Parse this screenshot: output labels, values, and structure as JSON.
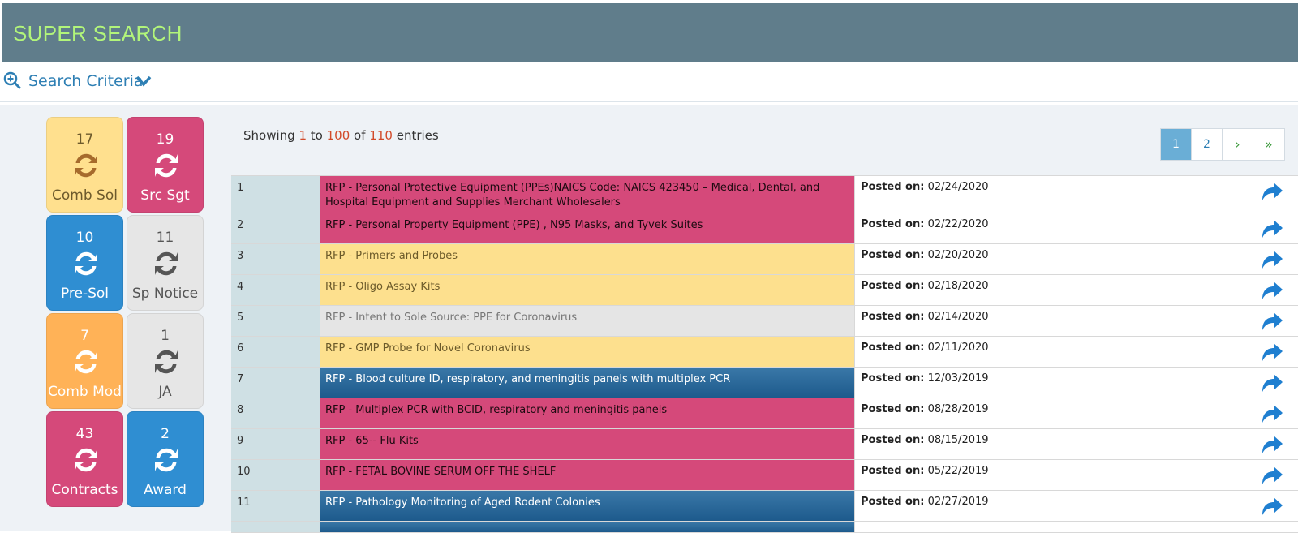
{
  "header": {
    "title": "SUPER SEARCH"
  },
  "criteria": {
    "label": "Search Criteria"
  },
  "tiles": [
    {
      "count": "17",
      "name": "Comb Sol"
    },
    {
      "count": "19",
      "name": "Src Sgt"
    },
    {
      "count": "10",
      "name": "Pre-Sol"
    },
    {
      "count": "11",
      "name": "Sp Notice"
    },
    {
      "count": "7",
      "name": "Comb Mod"
    },
    {
      "count": "1",
      "name": "JA"
    },
    {
      "count": "43",
      "name": "Contracts"
    },
    {
      "count": "2",
      "name": "Award"
    }
  ],
  "showing": {
    "prefix": "Showing",
    "from": "1",
    "to_word": "to",
    "to": "100",
    "of_word": "of",
    "total": "110",
    "suffix": "entries"
  },
  "pager": {
    "pages": [
      "1",
      "2"
    ],
    "next": "›",
    "last": "»"
  },
  "posted_label": "Posted on:",
  "rows": [
    {
      "num": "1",
      "title": "RFP - Personal Protective Equipment (PPEs)NAICS Code: NAICS 423450 – Medical, Dental, and Hospital Equipment and Supplies Merchant Wholesalers",
      "date": "02/24/2020"
    },
    {
      "num": "2",
      "title": "RFP - Personal Property Equipment (PPE) , N95 Masks, and Tyvek Suites",
      "date": "02/22/2020"
    },
    {
      "num": "3",
      "title": "RFP - Primers and Probes",
      "date": "02/20/2020"
    },
    {
      "num": "4",
      "title": "RFP - Oligo Assay Kits",
      "date": "02/18/2020"
    },
    {
      "num": "5",
      "title": "RFP - Intent to Sole Source: PPE for Coronavirus",
      "date": "02/14/2020"
    },
    {
      "num": "6",
      "title": "RFP - GMP Probe for Novel Coronavirus",
      "date": "02/11/2020"
    },
    {
      "num": "7",
      "title": "RFP - Blood culture ID, respiratory, and meningitis panels with multiplex PCR",
      "date": "12/03/2019"
    },
    {
      "num": "8",
      "title": "RFP - Multiplex PCR with BCID, respiratory and meningitis panels",
      "date": "08/28/2019"
    },
    {
      "num": "9",
      "title": "RFP - 65-- Flu Kits",
      "date": "08/15/2019"
    },
    {
      "num": "10",
      "title": "RFP - FETAL BOVINE SERUM OFF THE SHELF",
      "date": "05/22/2019"
    },
    {
      "num": "11",
      "title": "RFP - Pathology Monitoring of Aged Rodent Colonies",
      "date": "02/27/2019"
    }
  ]
}
